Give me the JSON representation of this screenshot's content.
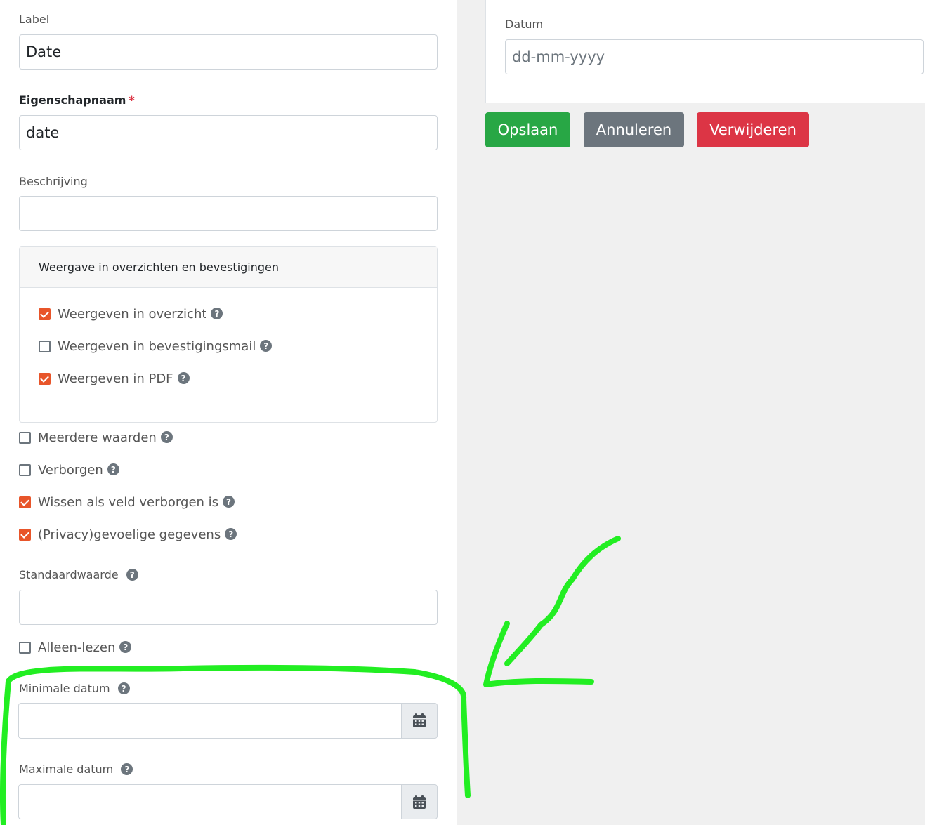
{
  "form": {
    "label_field": {
      "label": "Label",
      "value": "Date"
    },
    "property_name": {
      "label": "Eigenschapnaam",
      "required_mark": "*",
      "value": "date"
    },
    "description": {
      "label": "Beschrijving",
      "value": ""
    },
    "display_card": {
      "title": "Weergave in overzichten en bevestigingen",
      "options": [
        {
          "label": "Weergeven in overzicht",
          "checked": true
        },
        {
          "label": "Weergeven in bevestigingsmail",
          "checked": false
        },
        {
          "label": "Weergeven in PDF",
          "checked": true
        }
      ]
    },
    "options": [
      {
        "label": "Meerdere waarden",
        "checked": false
      },
      {
        "label": "Verborgen",
        "checked": false
      },
      {
        "label": "Wissen als veld verborgen is",
        "checked": true
      },
      {
        "label": "(Privacy)gevoelige gegevens",
        "checked": true
      }
    ],
    "default_value": {
      "label": "Standaardwaarde",
      "value": ""
    },
    "read_only": {
      "label": "Alleen-lezen",
      "checked": false
    },
    "min_date": {
      "label": "Minimale datum",
      "value": ""
    },
    "max_date": {
      "label": "Maximale datum",
      "value": ""
    },
    "help_glyph": "?"
  },
  "preview": {
    "label": "Datum",
    "placeholder": "dd-mm-yyyy"
  },
  "actions": {
    "save_label": "Opslaan",
    "cancel_label": "Annuleren",
    "delete_label": "Verwijderen"
  },
  "colors": {
    "checkbox_checked": "#e8552a",
    "save": "#28a745",
    "cancel": "#6c757d",
    "delete": "#dc3545",
    "annotation": "#22ee22"
  },
  "icons": {
    "help": "question-circle-icon",
    "calendar": "calendar-icon"
  }
}
